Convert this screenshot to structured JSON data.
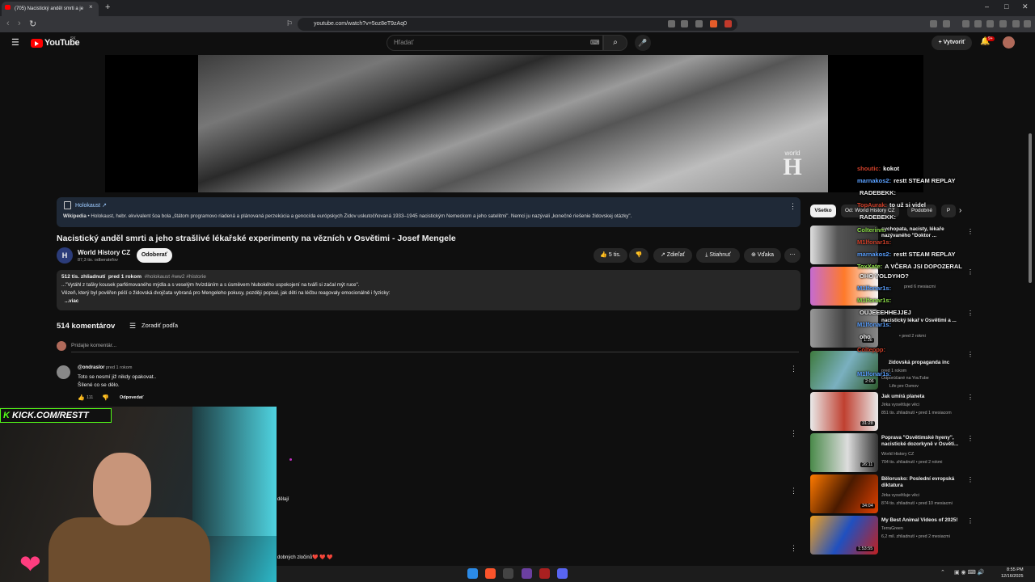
{
  "browser": {
    "tab_title": "(705) Nacistický anděl smrti a je",
    "tab_close": "×",
    "new_tab": "+",
    "url": "youtube.com/watch?v=5oz8eT9zAq0",
    "min": "–",
    "max": "□",
    "close": "✕"
  },
  "header": {
    "logo": "YouTube",
    "country": "SK",
    "search_placeholder": "Hľadať",
    "create": "+ Vytvoriť",
    "bell_badge": "9+"
  },
  "video": {
    "watermark_small": "world",
    "watermark_big": "H"
  },
  "info_panel": {
    "title": "Holokaust ↗",
    "source": "Wikipedia",
    "text": " • Holokaust, hebr. ekvivalent šoa bola „štátom programovo riadená a plánovaná perzekúcia a genocída európskych Židov uskutočňovaná 1933–1945 nacistickým Nemeckom a jeho satelitmi\". Nemci ju nazývali „konečné riešenie židovskej otázky\"."
  },
  "title": "Nacistický anděl smrti a jeho strašlivé lékařské experimenty na vězních v Osvětimi - Josef Mengele",
  "channel": {
    "initial": "H",
    "name": "World History CZ",
    "subs": "87,3 tis. odberateľov",
    "subscribe": "Odoberať"
  },
  "actions": {
    "likes": "👍 5 tis.",
    "dislike": "👎",
    "share": "↗ Zdieľať",
    "download": "⤓ Stiahnuť",
    "thanks": "⊕ Vďaka",
    "more": "⋯"
  },
  "description": {
    "views": "512 tis. zhliadnutí",
    "age": "pred 1 rokom",
    "tags": "#holokaust #ww2 #historie",
    "line1": "...\"Vytáhl z tašky kousek parfémovaného mýdla a s veselým hvízdáním a s úsměvem hlubokého uspokojení na tváři si začal mýt ruce\".",
    "line2": "Vězeň, který byl pověřen péčí o židovská dvojčata vybraná pro Mengeleho pokusy, později popsal, jak děti na léčbu reagovaly emocionálně i fyzicky:",
    "more": "...viac"
  },
  "comments": {
    "count": "514 komentárov",
    "sort": "Zoradiť podľa",
    "add_placeholder": "Pridajte komentár...",
    "items": [
      {
        "author": "@ondraslor",
        "time": "pred 1 rokom",
        "line1": "Toto se nesmí již nikdy opakovat..",
        "line2": "Šílené co se dělo.",
        "likes": "111",
        "reply": "Odpovedať"
      }
    ],
    "partial1": "dělají",
    "partial2_text": "dobných zločinů",
    "partial2_hearts": "❤️ ❤️ ❤️"
  },
  "stream": {
    "kick_prefix": "K",
    "kick_text": "KICK.COM/RESTT"
  },
  "chat": [
    {
      "user": "shoutic:",
      "msg": "kokot"
    },
    {
      "user": "marnakos2:",
      "msg": "restt STEAM REPLAY"
    },
    {
      "user": "",
      "msg": "RADEBEKK:"
    },
    {
      "user": "TopAurak:",
      "msg": "to už si videl"
    },
    {
      "user": "",
      "msg": "RADEBEKK:"
    },
    {
      "user": "Colterinn:",
      "msg": ""
    },
    {
      "user": "M1lfonar1s:",
      "msg": ""
    },
    {
      "user": "marnakos2:",
      "msg": "restt STEAM REPLAY"
    },
    {
      "user": "ToxXate:",
      "msg": "A VČERA JSI DOPOZERAL"
    },
    {
      "user": "",
      "msg": "OHO VOLDYHO?"
    },
    {
      "user": "M1lfonar1s:",
      "msg": ""
    },
    {
      "user": "M1lfonar1s:",
      "msg": ""
    },
    {
      "user": "",
      "msg": "OUJEEEHHEJJEJ"
    },
    {
      "user": "M1lfonar1s:",
      "msg": ""
    },
    {
      "user": "",
      "msg": "oho"
    },
    {
      "user": "Colteppp:",
      "msg": ""
    },
    {
      "user": "M1lfonar1s:",
      "msg": ""
    }
  ],
  "sidebar": {
    "chips": [
      "Všetko",
      "Od: World History CZ",
      "Podobné",
      "P"
    ],
    "items": [
      {
        "title": "sychopata, nacisty, lékaře nazývaného \"Doktor ...",
        "channel": "",
        "meta": "",
        "dur": ""
      },
      {
        "title": "",
        "channel": "",
        "meta": "pred 6 mesiacmi",
        "dur": ""
      },
      {
        "title": "nacistický lékař v Osvětimi a ...",
        "channel": "",
        "meta": "• pred 2 rokmi",
        "dur": "1:36"
      },
      {
        "title": "židovská propaganda inc",
        "channel": "pred 1 rokom",
        "meta": "Odporúčané na YouTube",
        "dur": "2:06"
      },
      {
        "title": "Jak umírá planeta",
        "channel": "Jirka vysvětluje věci",
        "meta": "851 tis. zhliadnutí • pred 1 mesiacom",
        "dur": "31:28"
      },
      {
        "title": "Poprava \"Osvětimské hyeny\", nacistické dozorkyně v Osvěti...",
        "channel": "World History CZ",
        "meta": "704 tis. zhliadnutí • pred 2 rokmi",
        "dur": "26:11"
      },
      {
        "title": "Bělorusko: Poslední evropská diktatura",
        "channel": "Jirka vysvětluje věci",
        "meta": "874 tis. zhliadnutí • pred 10 mesiacmi",
        "dur": "34:04"
      },
      {
        "title": "My Best Animal Videos of 2025!",
        "channel": "TerraGreen",
        "meta": "6,2 mil. zhliadnutí • pred 2 mesiacmi",
        "dur": "1:53:55"
      }
    ],
    "partial_title": "Life pre Osmov"
  },
  "taskbar": {
    "time": "8:55 PM",
    "date": "12/16/2025"
  },
  "colors": {
    "youtube_red": "#ff0000",
    "kick_green": "#53fc18",
    "subscribe_bg": "#f1f1f1"
  }
}
